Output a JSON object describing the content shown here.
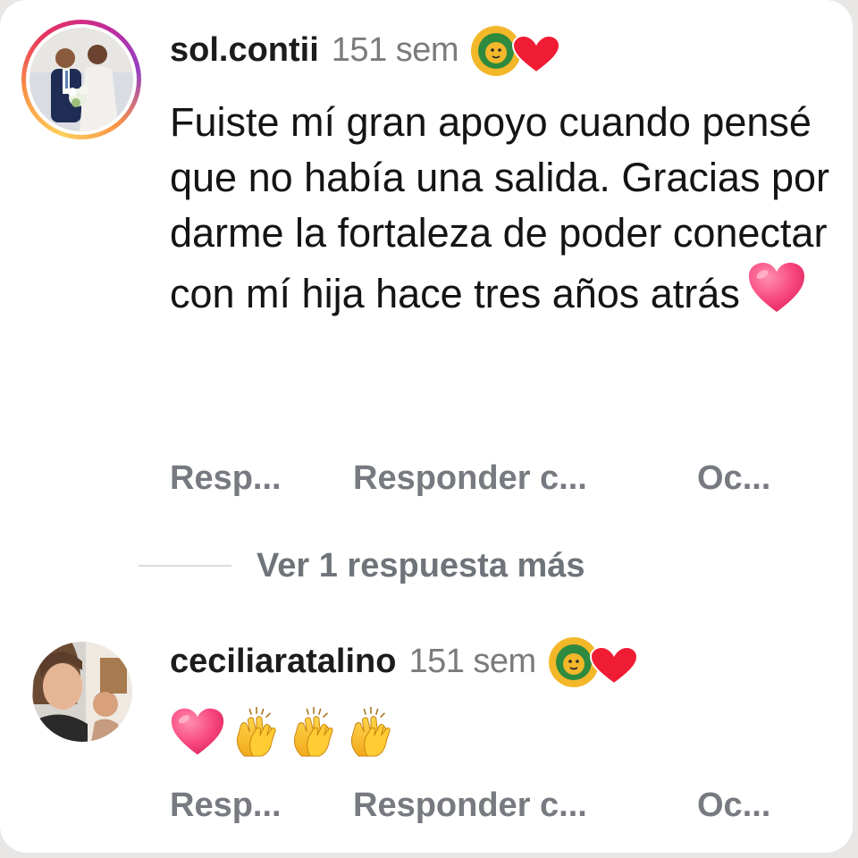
{
  "comments": [
    {
      "username": "sol.contii",
      "time": "151 sem",
      "text": "Fuiste mí gran apoyo cuando pensé que no había una salida. Gracias por darme la fortaleza de poder conectar con mí hija hace tres años atrás",
      "text_emoji": "heart",
      "avatar_has_story_ring": true,
      "badges": [
        "lion-icon",
        "red-heart-icon"
      ]
    },
    {
      "username": "ceciliaratalino",
      "time": "151 sem",
      "text_emojis": [
        "heart",
        "clapping-hands",
        "clapping-hands",
        "clapping-hands"
      ],
      "avatar_has_story_ring": false,
      "badges": [
        "lion-icon",
        "red-heart-icon"
      ]
    }
  ],
  "actions": {
    "reply": "Resp...",
    "reply_with": "Responder c...",
    "hide": "Oc..."
  },
  "view_more_replies": "Ver 1 respuesta más",
  "colors": {
    "username": "#1c1c1c",
    "meta": "#7b7b7b",
    "action": "#777a80",
    "story_ring": [
      "#fdd05a",
      "#f99246",
      "#e7325f",
      "#c62a93",
      "#9440c4"
    ]
  }
}
